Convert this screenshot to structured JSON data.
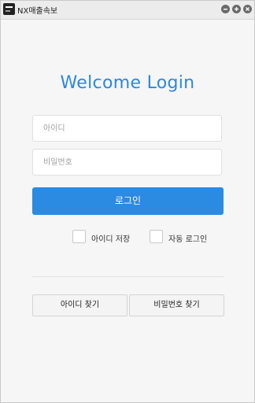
{
  "window": {
    "title": "NX매출속보",
    "controls": {
      "minimize": "−",
      "maximize": "+",
      "close": "×"
    }
  },
  "login": {
    "heading": "Welcome Login",
    "id_placeholder": "아이디",
    "id_value": "",
    "pw_placeholder": "비밀번호",
    "pw_value": "",
    "submit_label": "로그인",
    "save_id_label": "아이디 저장",
    "save_id_checked": false,
    "auto_login_label": "자동 로그인",
    "auto_login_checked": false,
    "find_id_label": "아이디 찾기",
    "find_pw_label": "비밀번호 찾기"
  },
  "colors": {
    "accent": "#2b8ae2",
    "heading": "#2b88e0",
    "background": "#f6f6f6"
  },
  "icons": {
    "app": "app-logo-icon",
    "minimize": "minimize-icon",
    "maximize": "maximize-icon",
    "close": "close-icon"
  }
}
